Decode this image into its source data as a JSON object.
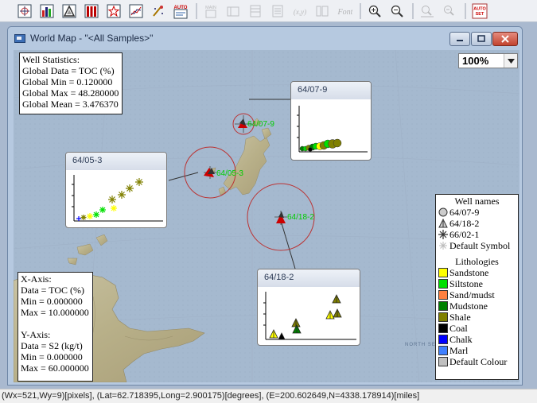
{
  "toolbar": {
    "buttons": [
      {
        "name": "crosshair-tool-icon",
        "enabled": true
      },
      {
        "name": "bar-chart-icon",
        "enabled": true
      },
      {
        "name": "triangle-icon",
        "enabled": true
      },
      {
        "name": "column-chart-icon",
        "enabled": true
      },
      {
        "name": "star-chart-icon",
        "enabled": true
      },
      {
        "name": "line-chart-icon",
        "enabled": true
      },
      {
        "name": "scatter-brush-icon",
        "enabled": true
      },
      {
        "name": "auto-layout-icon",
        "enabled": true,
        "label": "AUTO"
      },
      {
        "name": "main-icon",
        "enabled": false,
        "label": "MAIN"
      },
      {
        "name": "panel-icon",
        "enabled": false
      },
      {
        "name": "grid-icon",
        "enabled": false
      },
      {
        "name": "list-icon",
        "enabled": false
      },
      {
        "name": "xy-icon",
        "enabled": false,
        "label": "(x,y)"
      },
      {
        "name": "column-layout-icon",
        "enabled": false
      },
      {
        "name": "font-icon",
        "enabled": false,
        "label": "Font"
      },
      {
        "name": "zoom-in-icon",
        "enabled": true
      },
      {
        "name": "zoom-out-icon",
        "enabled": true
      },
      {
        "name": "zoom-fit-icon",
        "enabled": false
      },
      {
        "name": "zoom-reset-icon",
        "enabled": false
      },
      {
        "name": "auto-set-icon",
        "enabled": true,
        "label": "AUTO SET"
      }
    ]
  },
  "window": {
    "title": "World Map - \"<All Samples>\"",
    "zoom": "100%"
  },
  "stats": {
    "heading": "Well Statistics:",
    "data": "Global Data = TOC (%)",
    "min": "Global Min = 0.120000",
    "max": "Global Max = 48.280000",
    "mean": "Global Mean = 3.476370"
  },
  "axes": {
    "x_head": "X-Axis:",
    "x_data": "Data = TOC (%)",
    "x_min": "Min = 0.000000",
    "x_max": "Max = 10.000000",
    "y_head": "Y-Axis:",
    "y_data": "Data = S2 (kg/t)",
    "y_min": "Min = 0.000000",
    "y_max": "Max = 60.000000"
  },
  "legend": {
    "wells_title": "Well names",
    "wells": [
      "64/07-9",
      "64/18-2",
      "66/02-1",
      "Default Symbol"
    ],
    "lith_title": "Lithologies",
    "lithologies": [
      {
        "name": "Sandstone",
        "color": "#ffff00"
      },
      {
        "name": "Siltstone",
        "color": "#00e000"
      },
      {
        "name": "Sand/mudst",
        "color": "#ff8040"
      },
      {
        "name": "Mudstone",
        "color": "#008000"
      },
      {
        "name": "Shale",
        "color": "#808000"
      },
      {
        "name": "Coal",
        "color": "#000000"
      },
      {
        "name": "Chalk",
        "color": "#0000ff"
      },
      {
        "name": "Marl",
        "color": "#4080ff"
      },
      {
        "name": "Default Colour",
        "color": "#c0c0c0"
      }
    ]
  },
  "wells_on_map": [
    {
      "label": "64/07-9",
      "labelColor": "#00cc00"
    },
    {
      "label": "64/05-3",
      "labelColor": "#00cc00"
    },
    {
      "label": "64/18-2",
      "labelColor": "#00cc00"
    }
  ],
  "map_text": {
    "north_sea": "NORTH SE"
  },
  "popups": {
    "p1": {
      "title": "64/07-9"
    },
    "p2": {
      "title": "64/05-3"
    },
    "p3": {
      "title": "64/18-2"
    }
  },
  "status": "(Wx=521,Wy=9)[pixels], (Lat=62.718395,Long=2.900175)[degrees], (E=200.602649,N=4338.178914)[miles]"
}
